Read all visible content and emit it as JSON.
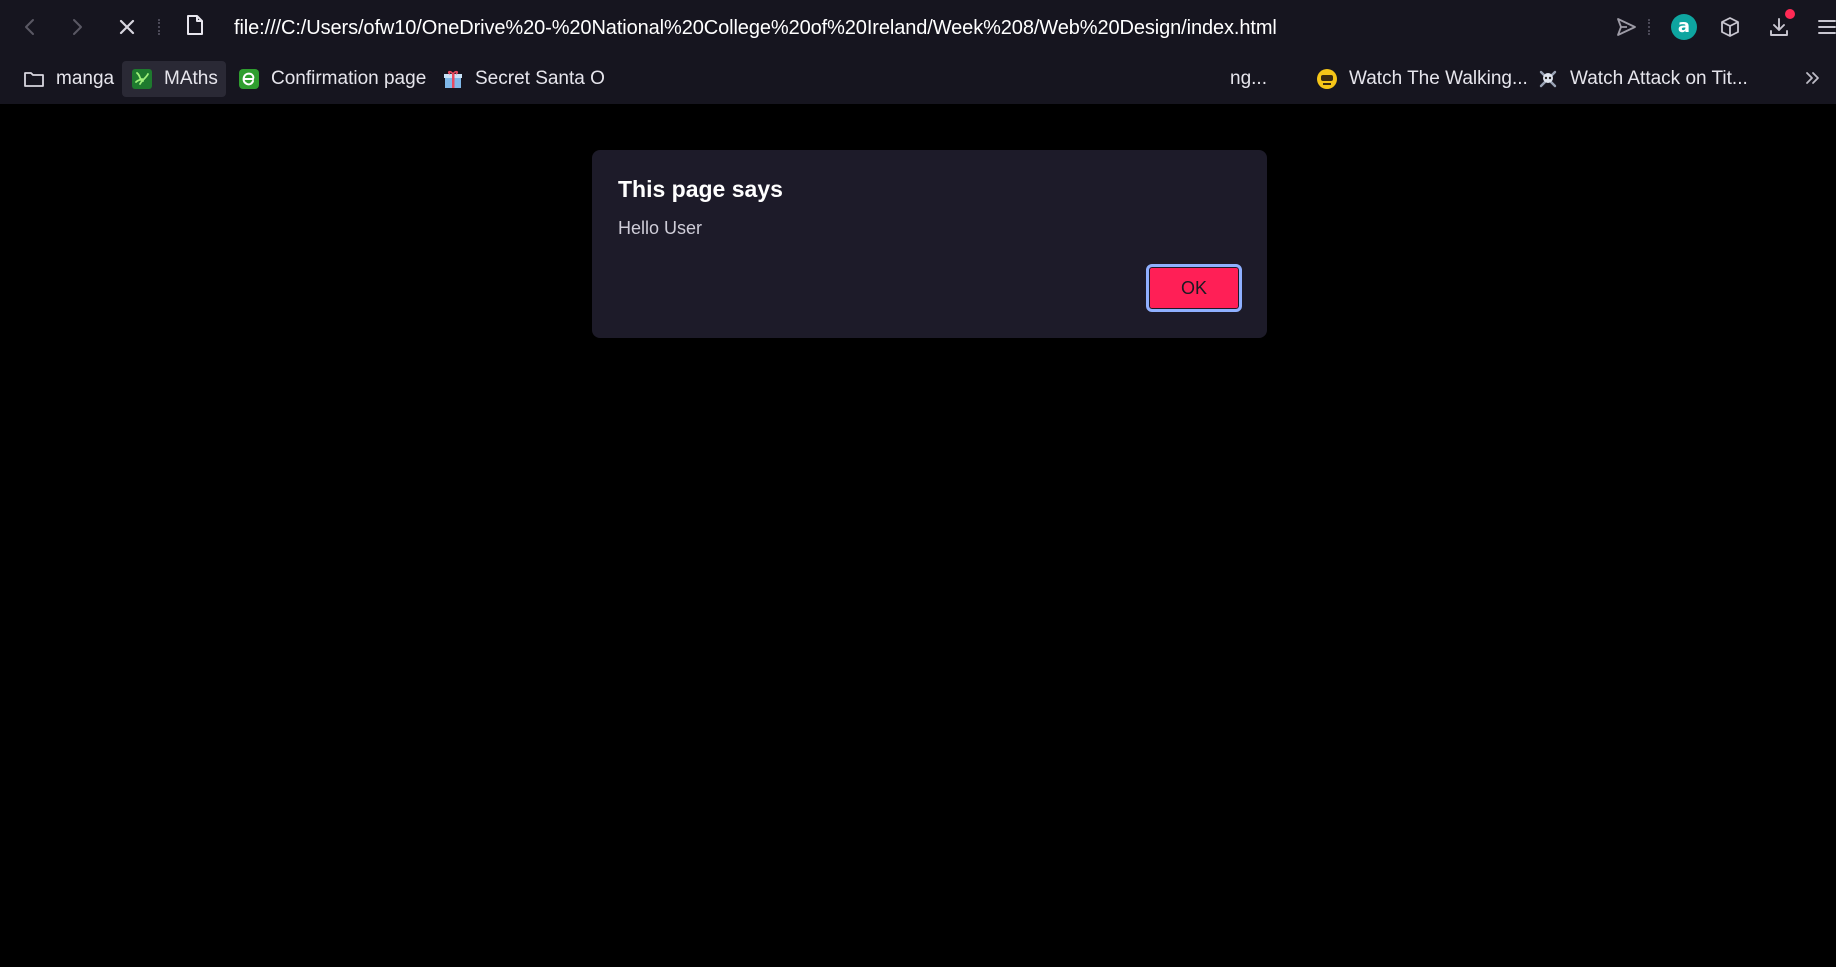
{
  "browser": {
    "url": "file:///C:/Users/ofw10/OneDrive%20-%20National%20College%20of%20Ireland/Week%208/Web%20Design/index.html",
    "bookmarks": [
      {
        "label": "manga",
        "icon": "folder-icon"
      },
      {
        "label": "MAths",
        "icon": "maths-site-icon",
        "active": true
      },
      {
        "label": "Confirmation page",
        "icon": "green-e-icon"
      },
      {
        "label": "Secret Santa O",
        "icon": "gift-icon"
      },
      {
        "label": "ng...",
        "icon": ""
      },
      {
        "label": "Watch The Walking...",
        "icon": "yellow-face-icon"
      },
      {
        "label": "Watch Attack on Tit...",
        "icon": "skull-icon"
      }
    ],
    "extension_letter": "a",
    "colors": {
      "chrome_bg": "#16151f",
      "accent": "#ff1f56",
      "extension": "#0ea5a0"
    }
  },
  "dialog": {
    "title": "This page says",
    "message": "Hello User",
    "ok_label": "OK"
  }
}
